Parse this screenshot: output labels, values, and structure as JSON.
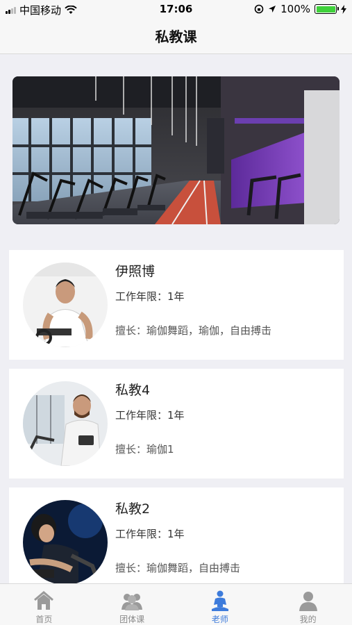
{
  "status": {
    "carrier": "中国移动",
    "time": "17:06",
    "battery": "100%"
  },
  "header": {
    "title": "私教课"
  },
  "banner": {
    "icon": "gym-treadmill-photo"
  },
  "coaches": [
    {
      "name": "伊照博",
      "years_label": "工作年限：",
      "years": "1年",
      "skill_label": "擅长：",
      "skills": "瑜伽舞蹈，瑜伽，自由搏击"
    },
    {
      "name": "私教4",
      "years_label": "工作年限：",
      "years": "1年",
      "skill_label": "擅长：",
      "skills": "瑜伽1"
    },
    {
      "name": "私教2",
      "years_label": "工作年限：",
      "years": "1年",
      "skill_label": "擅长：",
      "skills": "瑜伽舞蹈，自由搏击"
    }
  ],
  "tabs": [
    {
      "label": "首页",
      "icon": "home-icon",
      "active": false
    },
    {
      "label": "团体课",
      "icon": "group-icon",
      "active": false
    },
    {
      "label": "老师",
      "icon": "teacher-icon",
      "active": true
    },
    {
      "label": "我的",
      "icon": "profile-icon",
      "active": false
    }
  ],
  "colors": {
    "accent": "#3d7bdb",
    "inactive": "#9a9a9a",
    "background": "#efeff4"
  }
}
